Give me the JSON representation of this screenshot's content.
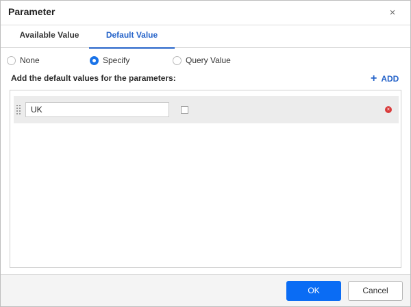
{
  "dialog": {
    "title": "Parameter",
    "close_icon": "×"
  },
  "tabs": [
    {
      "label": "Available Value",
      "active": false
    },
    {
      "label": "Default Value",
      "active": true
    }
  ],
  "radios": [
    {
      "label": "None",
      "checked": false
    },
    {
      "label": "Specify",
      "checked": true
    },
    {
      "label": "Query Value",
      "checked": false
    }
  ],
  "section": {
    "label": "Add the default values for the parameters:",
    "add_icon": "+",
    "add_label": "ADD"
  },
  "rows": [
    {
      "value": "UK",
      "checked": false,
      "remove_icon": "×"
    }
  ],
  "footer": {
    "ok_label": "OK",
    "cancel_label": "Cancel"
  },
  "colors": {
    "accent": "#2563c9",
    "primary_button": "#0a6cf4",
    "remove": "#d93a3a"
  }
}
